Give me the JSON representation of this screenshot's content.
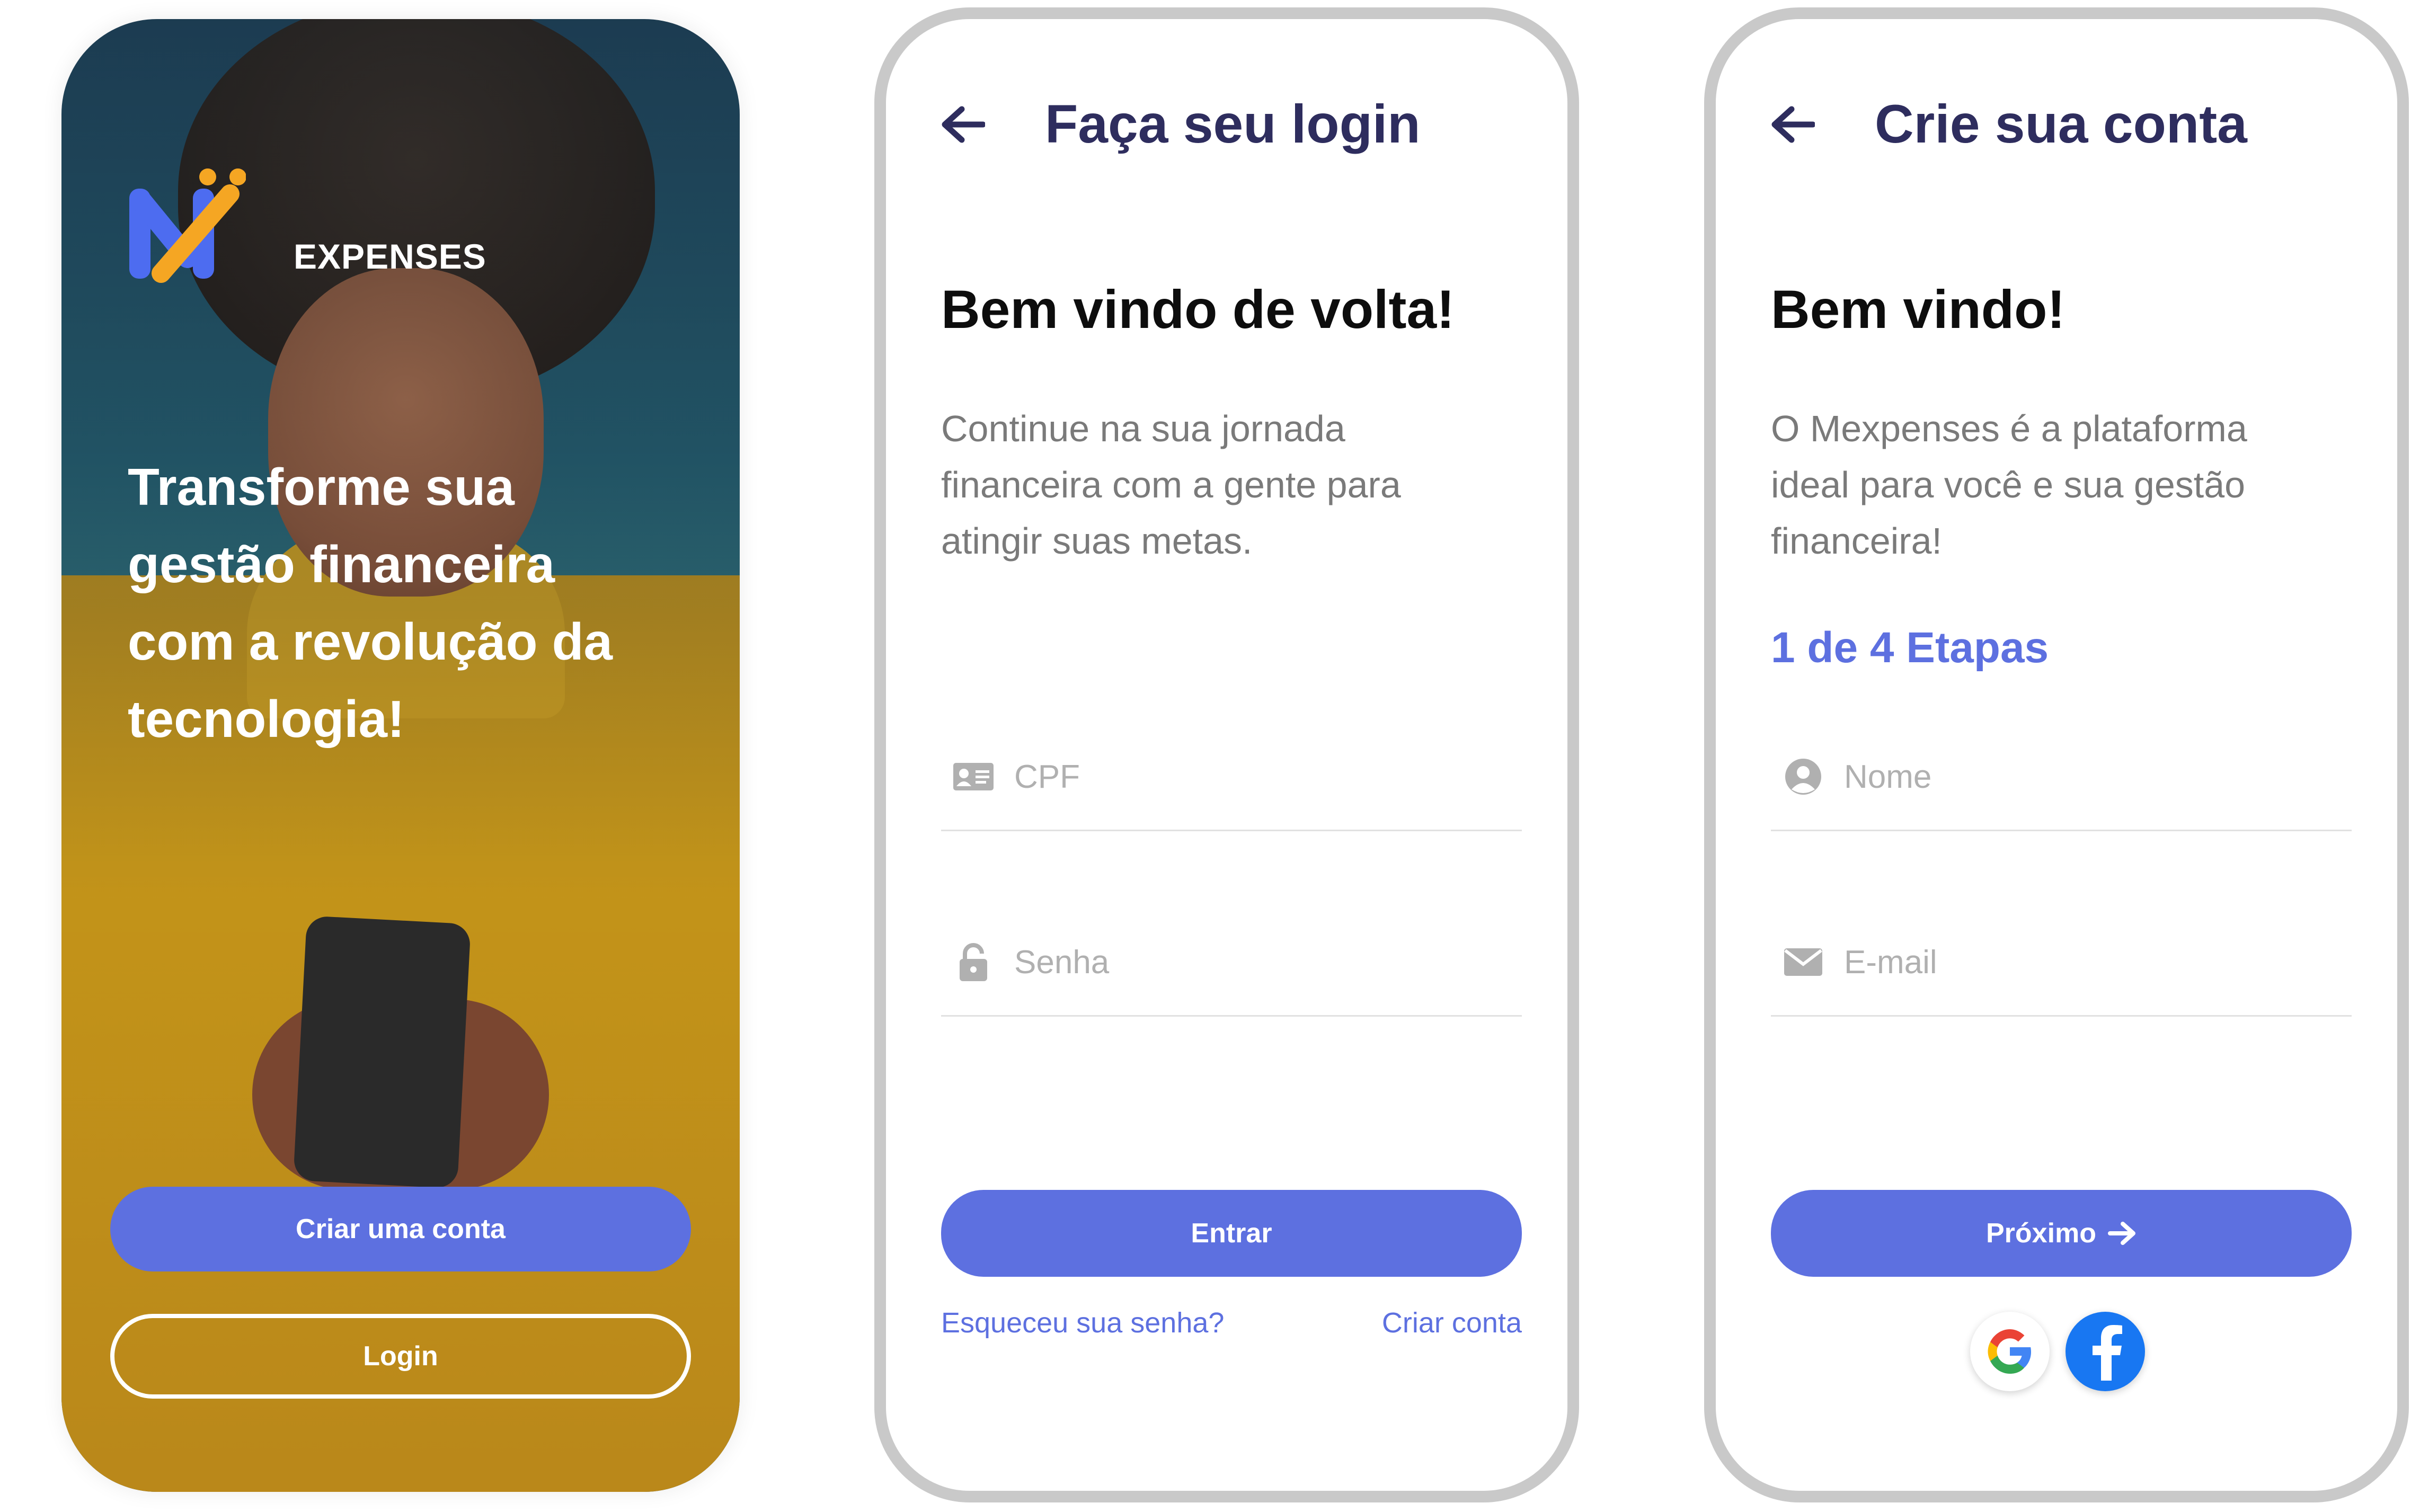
{
  "welcome_screen": {
    "logo_text": "EXPENSES",
    "headline": "Transforme sua gestão financeira com a revolução da tecnologia!",
    "create_button": "Criar uma conta",
    "login_button": "Login"
  },
  "login_screen": {
    "title": "Faça seu login",
    "welcome": "Bem vindo de volta!",
    "description": "Continue na sua jornada financeira com a gente para atingir suas metas.",
    "cpf_placeholder": "CPF",
    "password_placeholder": "Senha",
    "submit_button": "Entrar",
    "forgot_link": "Esqueceu sua senha?",
    "create_link": "Criar conta"
  },
  "signup_screen": {
    "title": "Crie sua conta",
    "welcome": "Bem vindo!",
    "description": "O Mexpenses é a plataforma ideal para você e sua gestão financeira!",
    "steps": "1 de 4 Etapas",
    "name_placeholder": "Nome",
    "email_placeholder": "E-mail",
    "next_button": "Próximo"
  },
  "colors": {
    "primary": "#5d70e0",
    "title": "#2e2d5e",
    "placeholder": "#b0b0b0",
    "logo_m_blue": "#4d6cf0",
    "logo_accent": "#f5a623"
  },
  "icons": [
    "arrow-left-icon",
    "id-card-icon",
    "lock-icon",
    "user-icon",
    "mail-icon",
    "arrow-right-icon",
    "google-icon",
    "facebook-icon"
  ]
}
